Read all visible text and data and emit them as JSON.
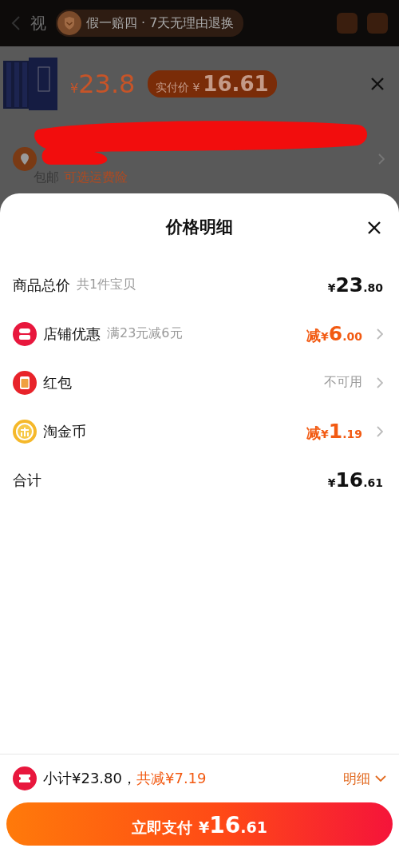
{
  "background_page": {
    "title": "视",
    "badge": "假一赔四 · 7天无理由退换",
    "product": {
      "price": {
        "currency": "¥",
        "value": "23.8"
      },
      "actual_price": {
        "label": "实付价",
        "currency": "¥",
        "value": "16.61"
      }
    },
    "shipping": {
      "label": "包邮",
      "option": "可选运费险"
    }
  },
  "sheet": {
    "title": "价格明细",
    "rows": [
      {
        "kind": "plain",
        "label": "商品总价",
        "note": "共1件宝贝",
        "discount": false,
        "amount": {
          "currency": "¥",
          "main": "23",
          "cents": ".80"
        }
      },
      {
        "kind": "shop",
        "label": "店铺优惠",
        "note": "满23元减6元",
        "discount": true,
        "amount": {
          "prefix": "减",
          "currency": "¥",
          "main": "6",
          "cents": ".00"
        }
      },
      {
        "kind": "redpacket",
        "label": "红包",
        "status": "不可用"
      },
      {
        "kind": "coin",
        "label": "淘金币",
        "discount": true,
        "amount": {
          "prefix": "减",
          "currency": "¥",
          "main": "1",
          "cents": ".19"
        }
      },
      {
        "kind": "plain",
        "label": "合计",
        "discount": false,
        "amount": {
          "currency": "¥",
          "main": "16",
          "cents": ".61"
        }
      }
    ]
  },
  "footer": {
    "subtotal": "小计¥23.80，",
    "saved": "共减¥7.19",
    "details_link": "明细",
    "pay_button": {
      "label": "立即支付",
      "currency": "¥",
      "main": "16",
      "cents": ".61"
    }
  }
}
